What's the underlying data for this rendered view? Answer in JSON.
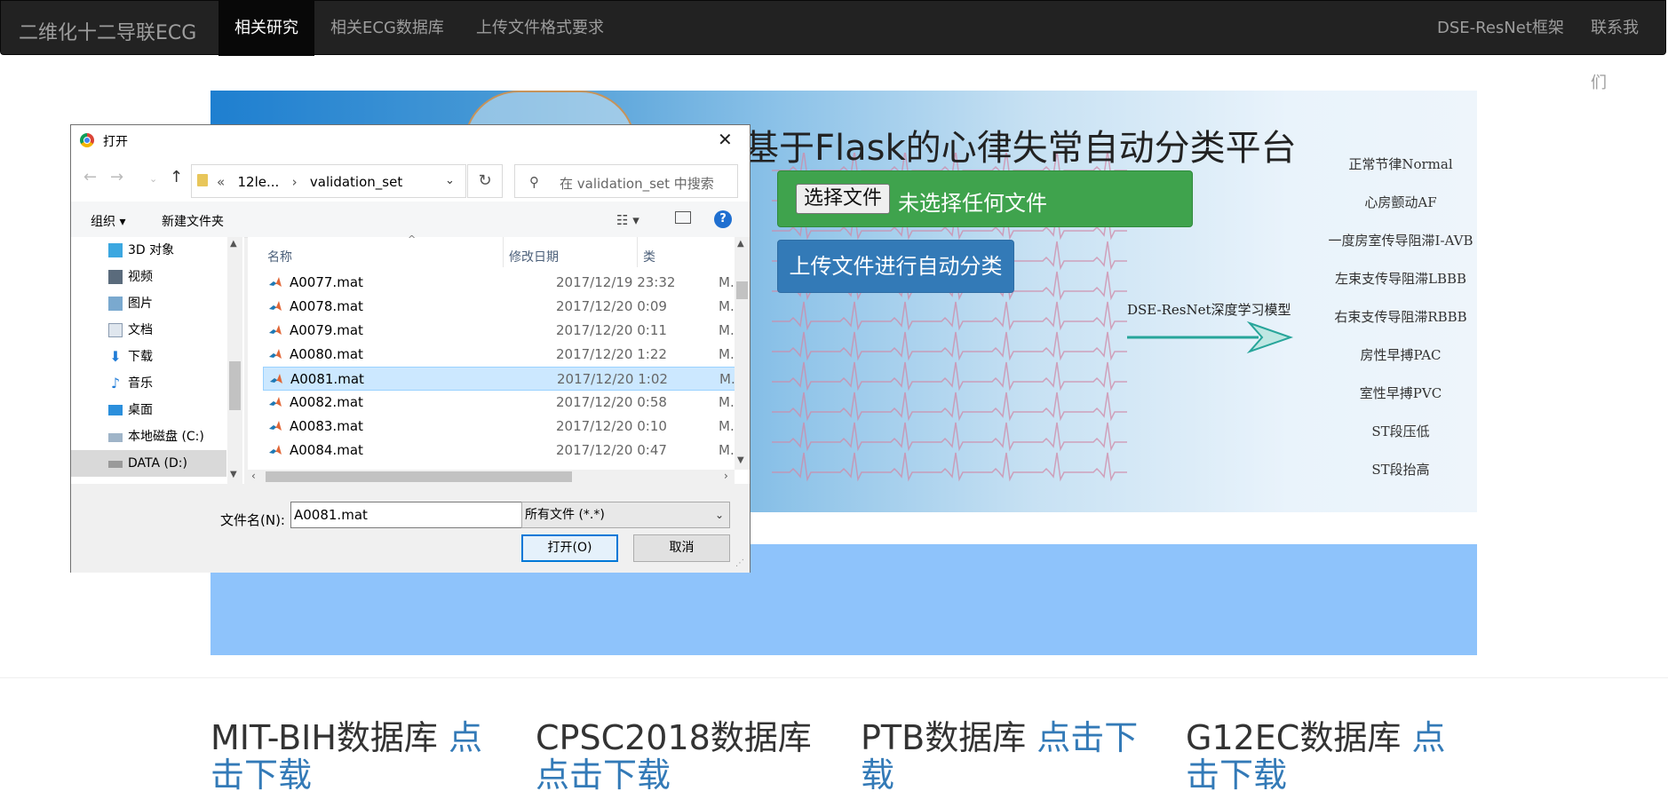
{
  "nav": {
    "brand": "二维化十二导联ECG",
    "items": [
      "相关研究",
      "相关ECG数据库",
      "上传文件格式要求"
    ],
    "right_items": [
      "DSE-ResNet框架",
      "联系我们"
    ]
  },
  "hero": {
    "title": "基于Flask的心律失常自动分类平台",
    "choose_button": "选择文件",
    "no_file_text": "未选择任何文件",
    "upload_button": "上传文件进行自动分类",
    "model_label": "DSE-ResNet深度学习模型",
    "classes": [
      "正常节律Normal",
      "心房颤动AF",
      "一度房室传导阻滞I-AVB",
      "左束支传导阻滞LBBB",
      "右束支传导阻滞RBBB",
      "房性早搏PAC",
      "室性早搏PVC",
      "ST段压低",
      "ST段抬高"
    ]
  },
  "databases": [
    {
      "name": "MIT-BIH数据库 ",
      "link": "点击下载"
    },
    {
      "name": "CPSC2018数据库 ",
      "link": "点击下载"
    },
    {
      "name": "PTB数据库 ",
      "link": "点击下载"
    },
    {
      "name": "G12EC数据库 ",
      "link": "点击下载"
    }
  ],
  "dialog": {
    "title": "打开",
    "path": [
      "«",
      "12le...",
      "›",
      "validation_set"
    ],
    "search_placeholder": "在 validation_set 中搜索",
    "toolbar": {
      "organize": "组织 ▾",
      "new_folder": "新建文件夹",
      "help": "?"
    },
    "tree": [
      {
        "label": "3D 对象",
        "icon": "cube-icon"
      },
      {
        "label": "视频",
        "icon": "video-icon"
      },
      {
        "label": "图片",
        "icon": "picture-icon"
      },
      {
        "label": "文档",
        "icon": "document-icon"
      },
      {
        "label": "下载",
        "icon": "download-icon"
      },
      {
        "label": "音乐",
        "icon": "music-icon"
      },
      {
        "label": "桌面",
        "icon": "desktop-icon"
      },
      {
        "label": "本地磁盘 (C:)",
        "icon": "drive-icon"
      },
      {
        "label": "DATA (D:)",
        "icon": "drive-icon",
        "selected": true
      }
    ],
    "columns": {
      "name": "名称",
      "date": "修改日期",
      "type": "类"
    },
    "files": [
      {
        "name": "A0077.mat",
        "date": "2017/12/19 23:32",
        "type": "M."
      },
      {
        "name": "A0078.mat",
        "date": "2017/12/20 0:09",
        "type": "M."
      },
      {
        "name": "A0079.mat",
        "date": "2017/12/20 0:11",
        "type": "M."
      },
      {
        "name": "A0080.mat",
        "date": "2017/12/20 1:22",
        "type": "M."
      },
      {
        "name": "A0081.mat",
        "date": "2017/12/20 1:02",
        "type": "M.",
        "selected": true
      },
      {
        "name": "A0082.mat",
        "date": "2017/12/20 0:58",
        "type": "M."
      },
      {
        "name": "A0083.mat",
        "date": "2017/12/20 0:10",
        "type": "M."
      },
      {
        "name": "A0084.mat",
        "date": "2017/12/20 0:47",
        "type": "M."
      }
    ],
    "filename_label": "文件名(N):",
    "filename_value": "A0081.mat",
    "filetype": "所有文件 (*.*)",
    "open_button": "打开(O)",
    "cancel_button": "取消"
  },
  "colors": {
    "navbar": "#222222",
    "primary": "#337ab7",
    "success": "#3fa34d",
    "banner": "#8ec3fb",
    "selection": "#cce8ff"
  }
}
